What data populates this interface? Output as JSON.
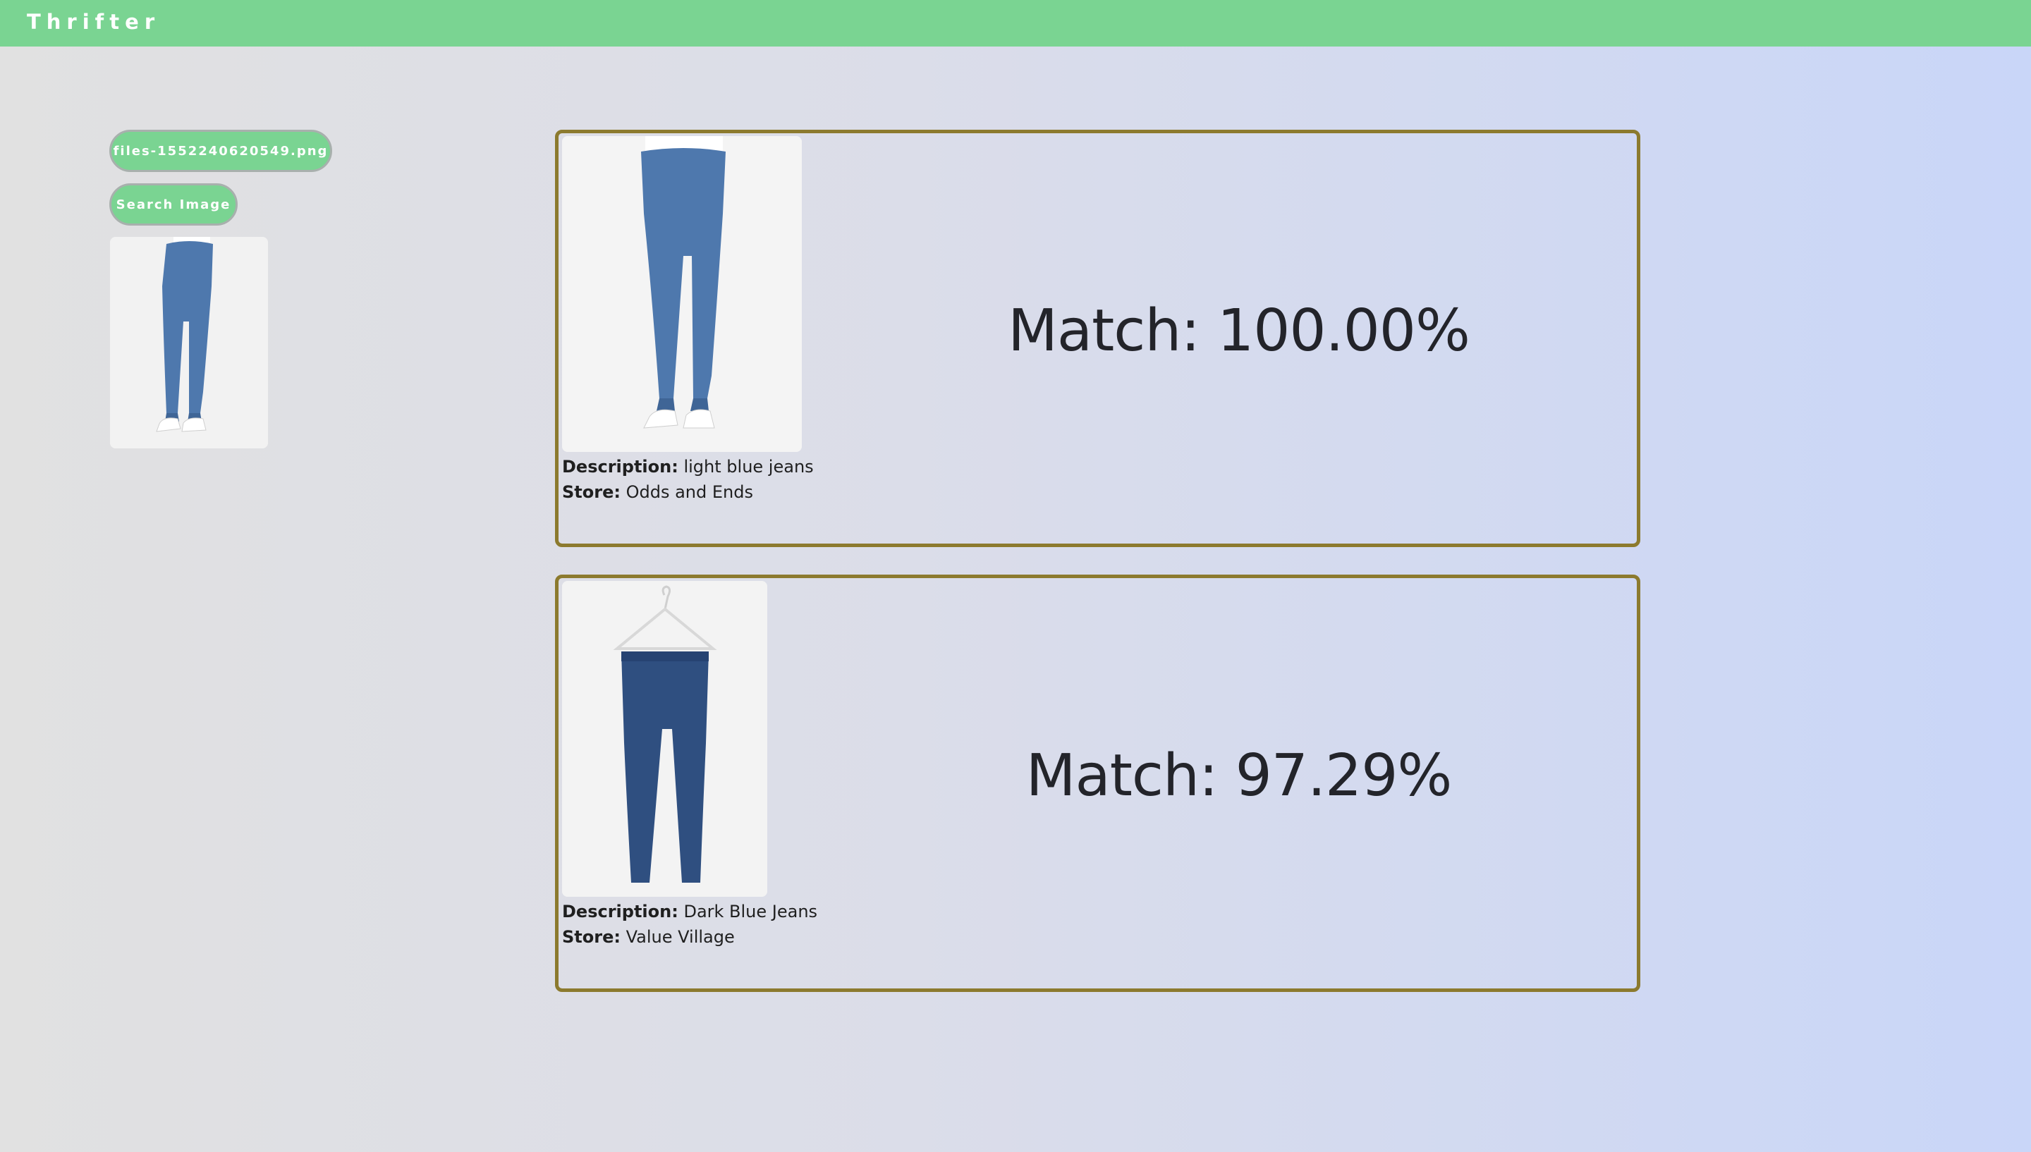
{
  "app": {
    "title": "Thrifter"
  },
  "upload": {
    "file_label": "files-1552240620549.png",
    "search_label": "Search Image"
  },
  "results": [
    {
      "match": "Match: 100.00%",
      "description_label": "Description:",
      "description": "light blue jeans",
      "store_label": "Store:",
      "store": "Odds and Ends"
    },
    {
      "match": "Match: 97.29%",
      "description_label": "Description:",
      "description": "Dark Blue Jeans",
      "store_label": "Store:",
      "store": "Value Village"
    }
  ],
  "colors": {
    "header": "#7ad492",
    "card_border": "#8c7a2e",
    "jeans_light": "#4e78ad",
    "jeans_dark": "#2f4f80"
  }
}
